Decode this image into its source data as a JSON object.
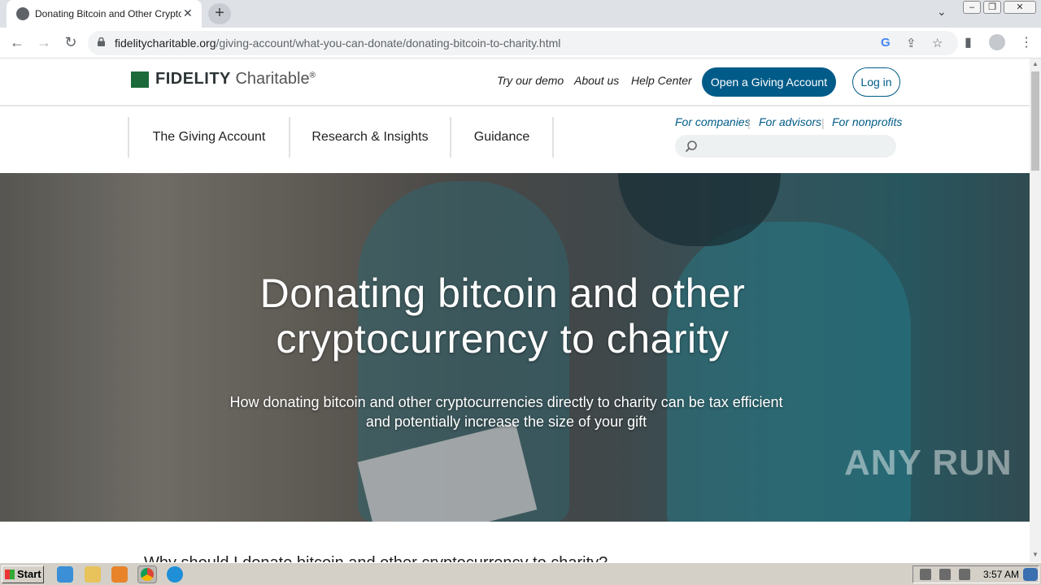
{
  "browser": {
    "tab_title": "Donating Bitcoin and Other Cryptocu",
    "new_tab": "+",
    "tab_close": "✕",
    "url_host": "fidelitycharitable.org",
    "url_path": "/giving-account/what-you-can-donate/donating-bitcoin-to-charity.html"
  },
  "site": {
    "logo_bold": "FIDELITY",
    "logo_light": "Charitable",
    "logo_mark": "®",
    "top_links": [
      "Try our demo",
      "About us",
      "Help Center"
    ],
    "open_account": "Open a Giving Account",
    "login": "Log in",
    "main_nav": [
      "The Giving Account",
      "Research & Insights",
      "Guidance"
    ],
    "sub_links": [
      "For companies",
      "For advisors",
      "For nonprofits"
    ],
    "search_placeholder": ""
  },
  "hero": {
    "title_line1": "Donating bitcoin and other",
    "title_line2": "cryptocurrency to charity",
    "subtitle": "How donating bitcoin and other cryptocurrencies directly to charity can be tax efficient and potentially increase the size of your gift"
  },
  "next_heading": "Why should I donate bitcoin and other cryptocurrency to charity?",
  "watermark": "ANY RUN",
  "taskbar": {
    "start": "Start",
    "clock": "3:57 AM"
  },
  "colors": {
    "brand": "#005b88",
    "logo_green": "#1c6a3a"
  }
}
